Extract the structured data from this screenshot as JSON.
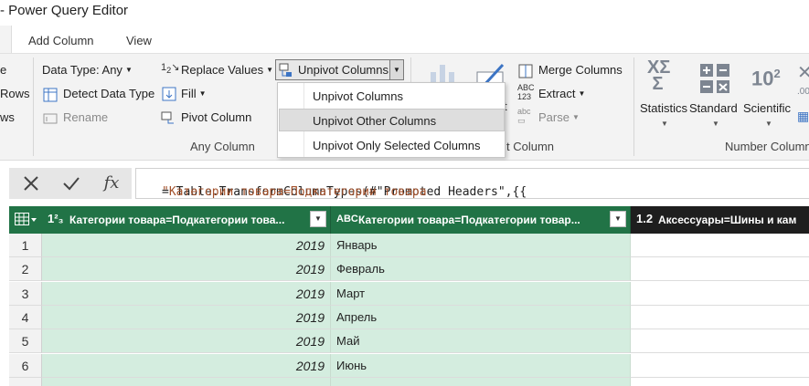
{
  "window": {
    "title": "- Power Query Editor"
  },
  "tabs": {
    "add_column": "Add Column",
    "view": "View"
  },
  "ribbon": {
    "left_partial": [
      "e",
      "Rows",
      "ws"
    ],
    "any_column": {
      "data_type": "Data Type: Any",
      "detect_data_type": "Detect Data Type",
      "rename": "Rename",
      "replace_values": "Replace Values",
      "fill": "Fill",
      "pivot_column": "Pivot Column",
      "unpivot_columns": "Unpivot Columns",
      "group_label": "Any Column"
    },
    "text_column": {
      "partial_t": "t",
      "merge_columns": "Merge Columns",
      "extract": "Extract",
      "parse": "Parse",
      "group_label_partial": "t Column"
    },
    "number_column": {
      "statistics": "Statistics",
      "standard": "Standard",
      "scientific": "Scientific",
      "group_label": "Number Column"
    }
  },
  "unpivot_menu": {
    "items": [
      "Unpivot Columns",
      "Unpivot Other Columns",
      "Unpivot Only Selected Columns"
    ],
    "highlighted": "Unpivot Other Columns"
  },
  "formula_bar": {
    "code": "= Table.TransformColumnTypes(#\"Promoted Headers\",{{",
    "string": "\"Категории товара=Подкатегории товара"
  },
  "table": {
    "columns": [
      {
        "type": "1²₃",
        "name": "Категории товара=Подкатегории това..."
      },
      {
        "type": "ABC",
        "name": "Категории товара=Подкатегории товар..."
      },
      {
        "type": "1.2",
        "name": "Аксессуары=Шины и кам"
      }
    ],
    "rows": [
      {
        "n": "1",
        "year": "2019",
        "month": "Январь"
      },
      {
        "n": "2",
        "year": "2019",
        "month": "Февраль"
      },
      {
        "n": "3",
        "year": "2019",
        "month": "Март"
      },
      {
        "n": "4",
        "year": "2019",
        "month": "Апрель"
      },
      {
        "n": "5",
        "year": "2019",
        "month": "Май"
      },
      {
        "n": "6",
        "year": "2019",
        "month": "Июнь"
      }
    ]
  },
  "colors": {
    "header_green": "#217346",
    "cell_green": "#d4eddf",
    "string_color": "#a3512b"
  }
}
